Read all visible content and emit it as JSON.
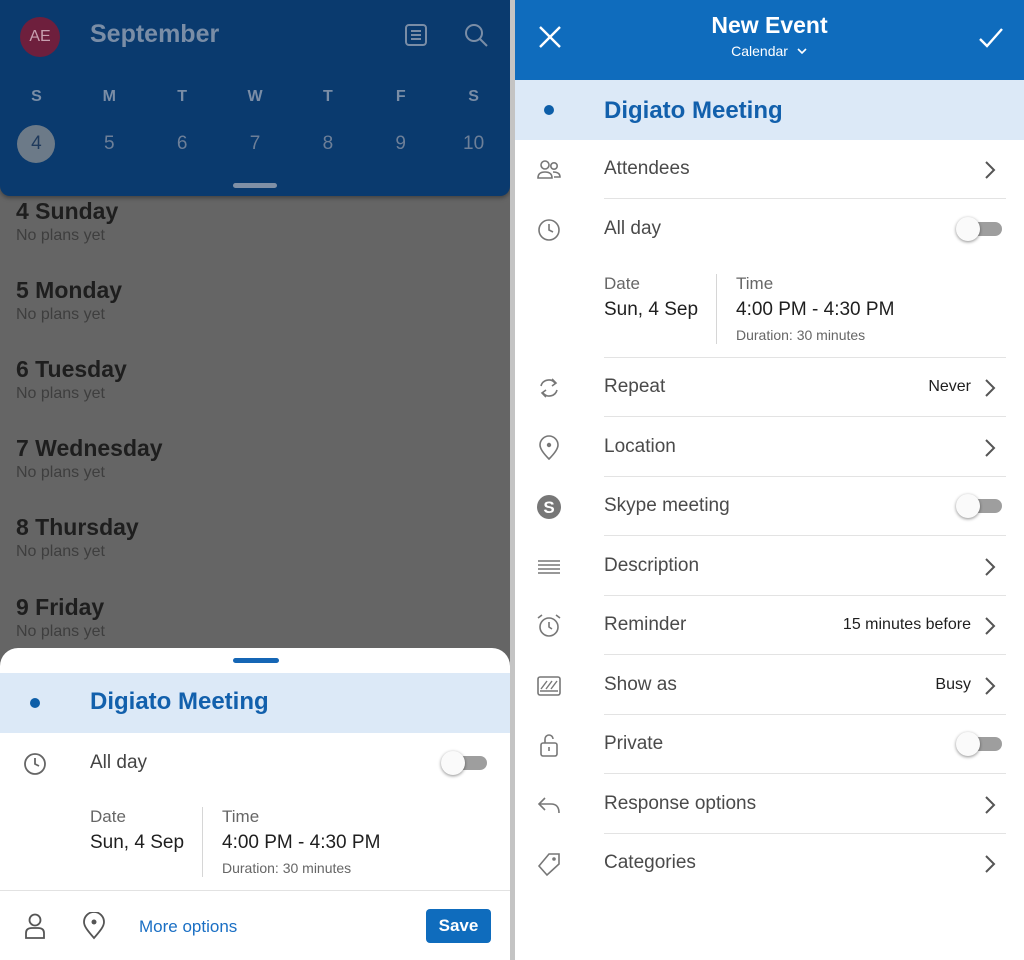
{
  "left": {
    "avatar_initials": "AE",
    "month_title": "September",
    "weekdays": [
      "S",
      "M",
      "T",
      "W",
      "T",
      "F",
      "S"
    ],
    "dates": [
      "4",
      "5",
      "6",
      "7",
      "8",
      "9",
      "10"
    ],
    "days": [
      {
        "title": "4 Sunday",
        "subtitle": "No plans yet"
      },
      {
        "title": "5 Monday",
        "subtitle": "No plans yet"
      },
      {
        "title": "6 Tuesday",
        "subtitle": "No plans yet"
      },
      {
        "title": "7 Wednesday",
        "subtitle": "No plans yet"
      },
      {
        "title": "8 Thursday",
        "subtitle": "No plans yet"
      },
      {
        "title": "9 Friday",
        "subtitle": "No plans yet"
      }
    ],
    "sheet": {
      "event_title": "Digiato Meeting",
      "all_day_label": "All day",
      "date_label": "Date",
      "date_value": "Sun, 4 Sep",
      "time_label": "Time",
      "time_value": "4:00 PM - 4:30 PM",
      "duration": "Duration: 30 minutes",
      "more_options": "More options",
      "save": "Save"
    }
  },
  "right": {
    "title": "New Event",
    "subtitle": "Calendar",
    "event_title": "Digiato Meeting",
    "attendees": "Attendees",
    "all_day": "All day",
    "date_label": "Date",
    "date_value": "Sun, 4 Sep",
    "time_label": "Time",
    "time_value": "4:00 PM - 4:30 PM",
    "duration": "Duration: 30 minutes",
    "repeat": "Repeat",
    "repeat_value": "Never",
    "location": "Location",
    "skype": "Skype meeting",
    "description": "Description",
    "reminder": "Reminder",
    "reminder_value": "15 minutes before",
    "show_as": "Show as",
    "show_as_value": "Busy",
    "private": "Private",
    "response_options": "Response options",
    "categories": "Categories"
  },
  "colors": {
    "accent": "#0f6cbd",
    "header_dark": "#0a3a6e",
    "title_highlight": "#dce9f7"
  },
  "icons": [
    "avatar",
    "list-view-icon",
    "search-icon",
    "clock-icon",
    "person-icon",
    "location-pin-icon",
    "close-icon",
    "check-icon",
    "chevron-down-icon",
    "chevron-right-icon",
    "people-icon",
    "repeat-icon",
    "skype-icon",
    "description-lines-icon",
    "alarm-icon",
    "show-as-icon",
    "lock-open-icon",
    "reply-icon",
    "tag-icon"
  ]
}
